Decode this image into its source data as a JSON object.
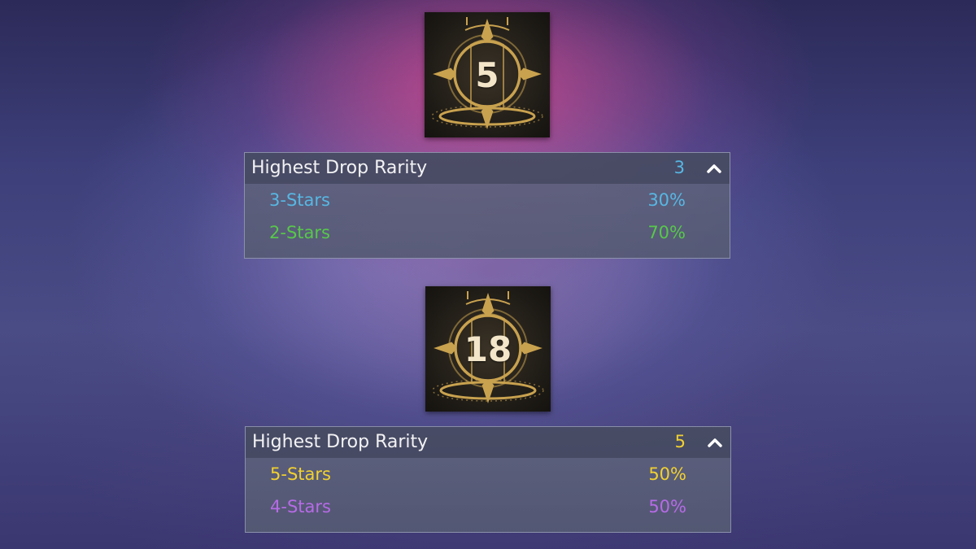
{
  "colors": {
    "blue": "#57b7e3",
    "green": "#57c84a",
    "yellow": "#f2d12f",
    "purple": "#b66be6",
    "gold": "#d8b55c"
  },
  "sections": [
    {
      "level": "5",
      "header": {
        "title": "Highest Drop Rarity",
        "rarity": "3",
        "chevron_icon": "chevron-up-icon"
      },
      "rows": [
        {
          "label": "3-Stars",
          "percent": "30%"
        },
        {
          "label": "2-Stars",
          "percent": "70%"
        }
      ]
    },
    {
      "level": "18",
      "header": {
        "title": "Highest Drop Rarity",
        "rarity": "5",
        "chevron_icon": "chevron-up-icon"
      },
      "rows": [
        {
          "label": "5-Stars",
          "percent": "50%"
        },
        {
          "label": "4-Stars",
          "percent": "50%"
        }
      ]
    }
  ]
}
